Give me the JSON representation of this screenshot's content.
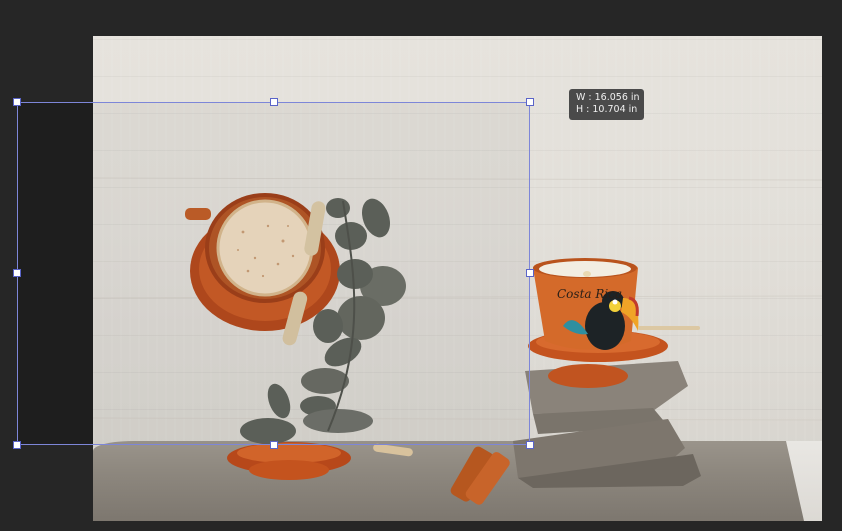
{
  "transform_readout": {
    "width_text": "W : 16.056 in",
    "height_text": "H : 10.704 in"
  },
  "cup_text": "Costa Rica",
  "colors": {
    "pasteboard": "#262626",
    "selection_border": "#7d86d8",
    "handle_fill": "#ffffff",
    "tooltip_bg": "#4a4a4a",
    "wood_wall": "#e2dfd9",
    "clay_orange": "#c2521b"
  },
  "icons": [
    "transform-handle"
  ]
}
